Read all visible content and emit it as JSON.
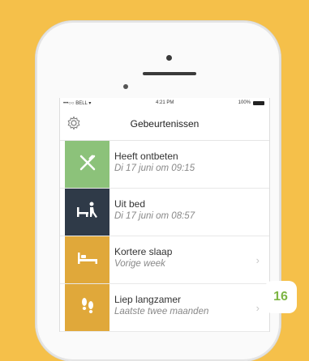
{
  "status_bar": {
    "carrier": "•••○○ BELL ▾",
    "time": "4:21 PM",
    "battery": "100%"
  },
  "header": {
    "title": "Gebeurtenissen"
  },
  "events": [
    {
      "title": "Heeft ontbeten",
      "subtitle": "Di 17 juni om 09:15",
      "icon": "fork-knife-icon",
      "color": "#8cc27a"
    },
    {
      "title": "Uit bed",
      "subtitle": "Di 17 juni om 08:57",
      "icon": "person-leaving-bed-icon",
      "color": "#2f3a48"
    },
    {
      "title": "Kortere slaap",
      "subtitle": "Vorige week",
      "icon": "bed-icon",
      "color": "#e0a83a"
    },
    {
      "title": "Liep langzamer",
      "subtitle": "Laatste twee maanden",
      "icon": "footprints-icon",
      "color": "#e0a83a"
    }
  ],
  "page_badge": "16",
  "colors": {
    "background": "#f5c04a",
    "badge_text": "#7db544"
  }
}
